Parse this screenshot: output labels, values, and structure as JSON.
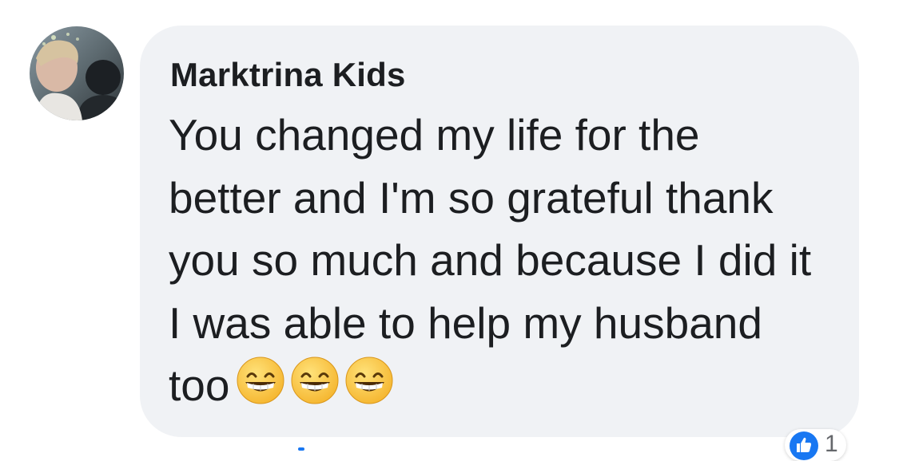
{
  "comment": {
    "author": "Marktrina Kids",
    "text": "You changed my life for the better and I'm so grateful thank you so much and because I did it I was able to help my husband too",
    "emojis": [
      "grinning-face-with-smiling-eyes",
      "grinning-face-with-smiling-eyes",
      "grinning-face-with-smiling-eyes"
    ],
    "reaction": {
      "icon": "like-icon",
      "count": "1",
      "color": "#1877f2"
    }
  },
  "colors": {
    "bubble": "#f0f2f5",
    "text": "#1c1e21",
    "secondary_text": "#65676b"
  }
}
